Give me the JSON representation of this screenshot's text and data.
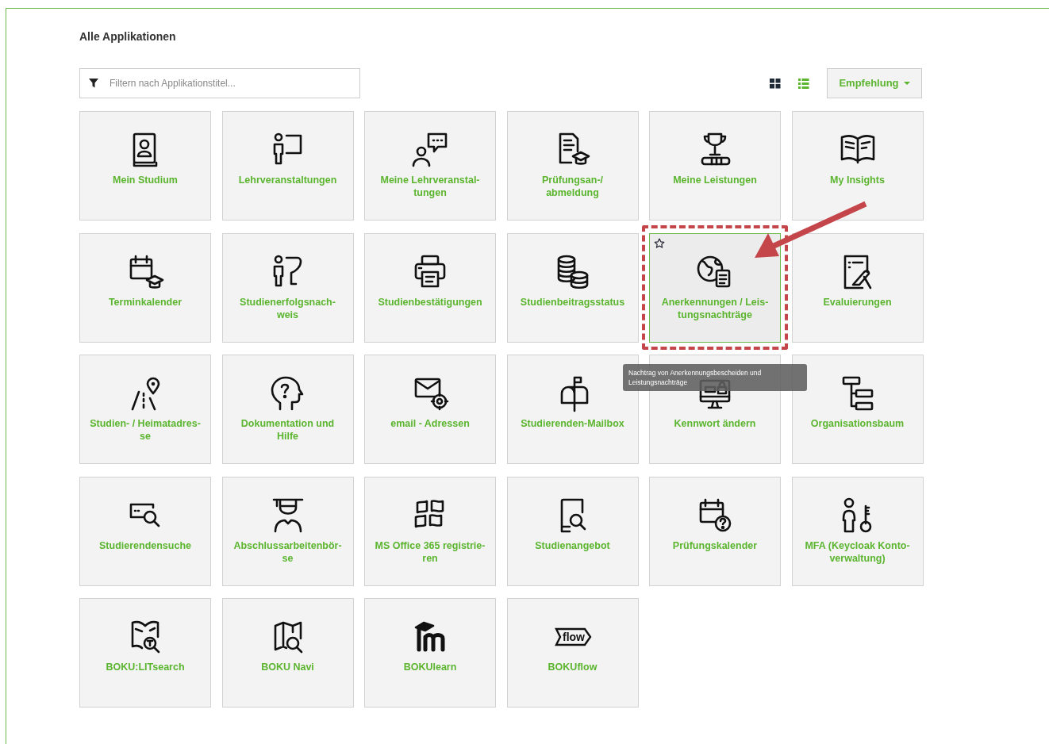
{
  "page": {
    "title": "Alle Applikationen"
  },
  "filter": {
    "placeholder": "Filtern nach Applikationstitel..."
  },
  "view_toggle": [
    {
      "selected": true
    },
    {
      "selected": false
    }
  ],
  "sort_button": {
    "label": "Empfehlung"
  },
  "apps": [
    {
      "lines": [
        "Mein Studium"
      ],
      "hovered": false,
      "highlighted": false
    },
    {
      "lines": [
        "Lehrveranstaltungen"
      ],
      "hovered": false,
      "highlighted": false
    },
    {
      "lines": [
        "Meine Lehrveranstal-",
        "tungen"
      ],
      "hovered": false,
      "highlighted": false
    },
    {
      "lines": [
        "Prüfungsan-/",
        "abmeldung"
      ],
      "hovered": false,
      "highlighted": false
    },
    {
      "lines": [
        "Meine Leistungen"
      ],
      "hovered": false,
      "highlighted": false
    },
    {
      "lines": [
        "My Insights"
      ],
      "hovered": false,
      "highlighted": false
    },
    {
      "lines": [
        "Terminkalender"
      ],
      "hovered": false,
      "highlighted": false
    },
    {
      "lines": [
        "Studienerfolgsnach-",
        "weis"
      ],
      "hovered": false,
      "highlighted": false
    },
    {
      "lines": [
        "Studienbestätigungen"
      ],
      "hovered": false,
      "highlighted": false
    },
    {
      "lines": [
        "Studienbeitragsstatus"
      ],
      "hovered": false,
      "highlighted": false
    },
    {
      "lines": [
        "Anerkennungen / Leis-",
        "tungsnachträge"
      ],
      "hovered": true,
      "highlighted": true,
      "tooltip": [
        "Nachtrag von Anerkennungsbescheiden und",
        "Leistungsnachträge"
      ]
    },
    {
      "lines": [
        "Evaluierungen"
      ],
      "hovered": false,
      "highlighted": false
    },
    {
      "lines": [
        "Studien- / Heimatadres-",
        "se"
      ],
      "hovered": false,
      "highlighted": false
    },
    {
      "lines": [
        "Dokumentation und",
        "Hilfe"
      ],
      "hovered": false,
      "highlighted": false
    },
    {
      "lines": [
        "email - Adressen"
      ],
      "hovered": false,
      "highlighted": false
    },
    {
      "lines": [
        "Studierenden-Mailbox"
      ],
      "hovered": false,
      "highlighted": false
    },
    {
      "lines": [
        "Kennwort ändern"
      ],
      "hovered": false,
      "highlighted": false
    },
    {
      "lines": [
        "Organisationsbaum"
      ],
      "hovered": false,
      "highlighted": false
    },
    {
      "lines": [
        "Studierendensuche"
      ],
      "hovered": false,
      "highlighted": false
    },
    {
      "lines": [
        "Abschlussarbeitenbör-",
        "se"
      ],
      "hovered": false,
      "highlighted": false
    },
    {
      "lines": [
        "MS Office 365 registrie-",
        "ren"
      ],
      "hovered": false,
      "highlighted": false
    },
    {
      "lines": [
        "Studienangebot"
      ],
      "hovered": false,
      "highlighted": false
    },
    {
      "lines": [
        "Prüfungskalender"
      ],
      "hovered": false,
      "highlighted": false
    },
    {
      "lines": [
        "MFA (Keycloak Konto-",
        "verwaltung)"
      ],
      "hovered": false,
      "highlighted": false
    },
    {
      "lines": [
        "BOKU:LITsearch"
      ],
      "hovered": false,
      "highlighted": false
    },
    {
      "lines": [
        "BOKU Navi"
      ],
      "hovered": false,
      "highlighted": false
    },
    {
      "lines": [
        "BOKUlearn"
      ],
      "hovered": false,
      "highlighted": false
    },
    {
      "lines": [
        "BOKUflow"
      ],
      "hovered": false,
      "highlighted": false,
      "logo_text": "flow"
    }
  ]
}
